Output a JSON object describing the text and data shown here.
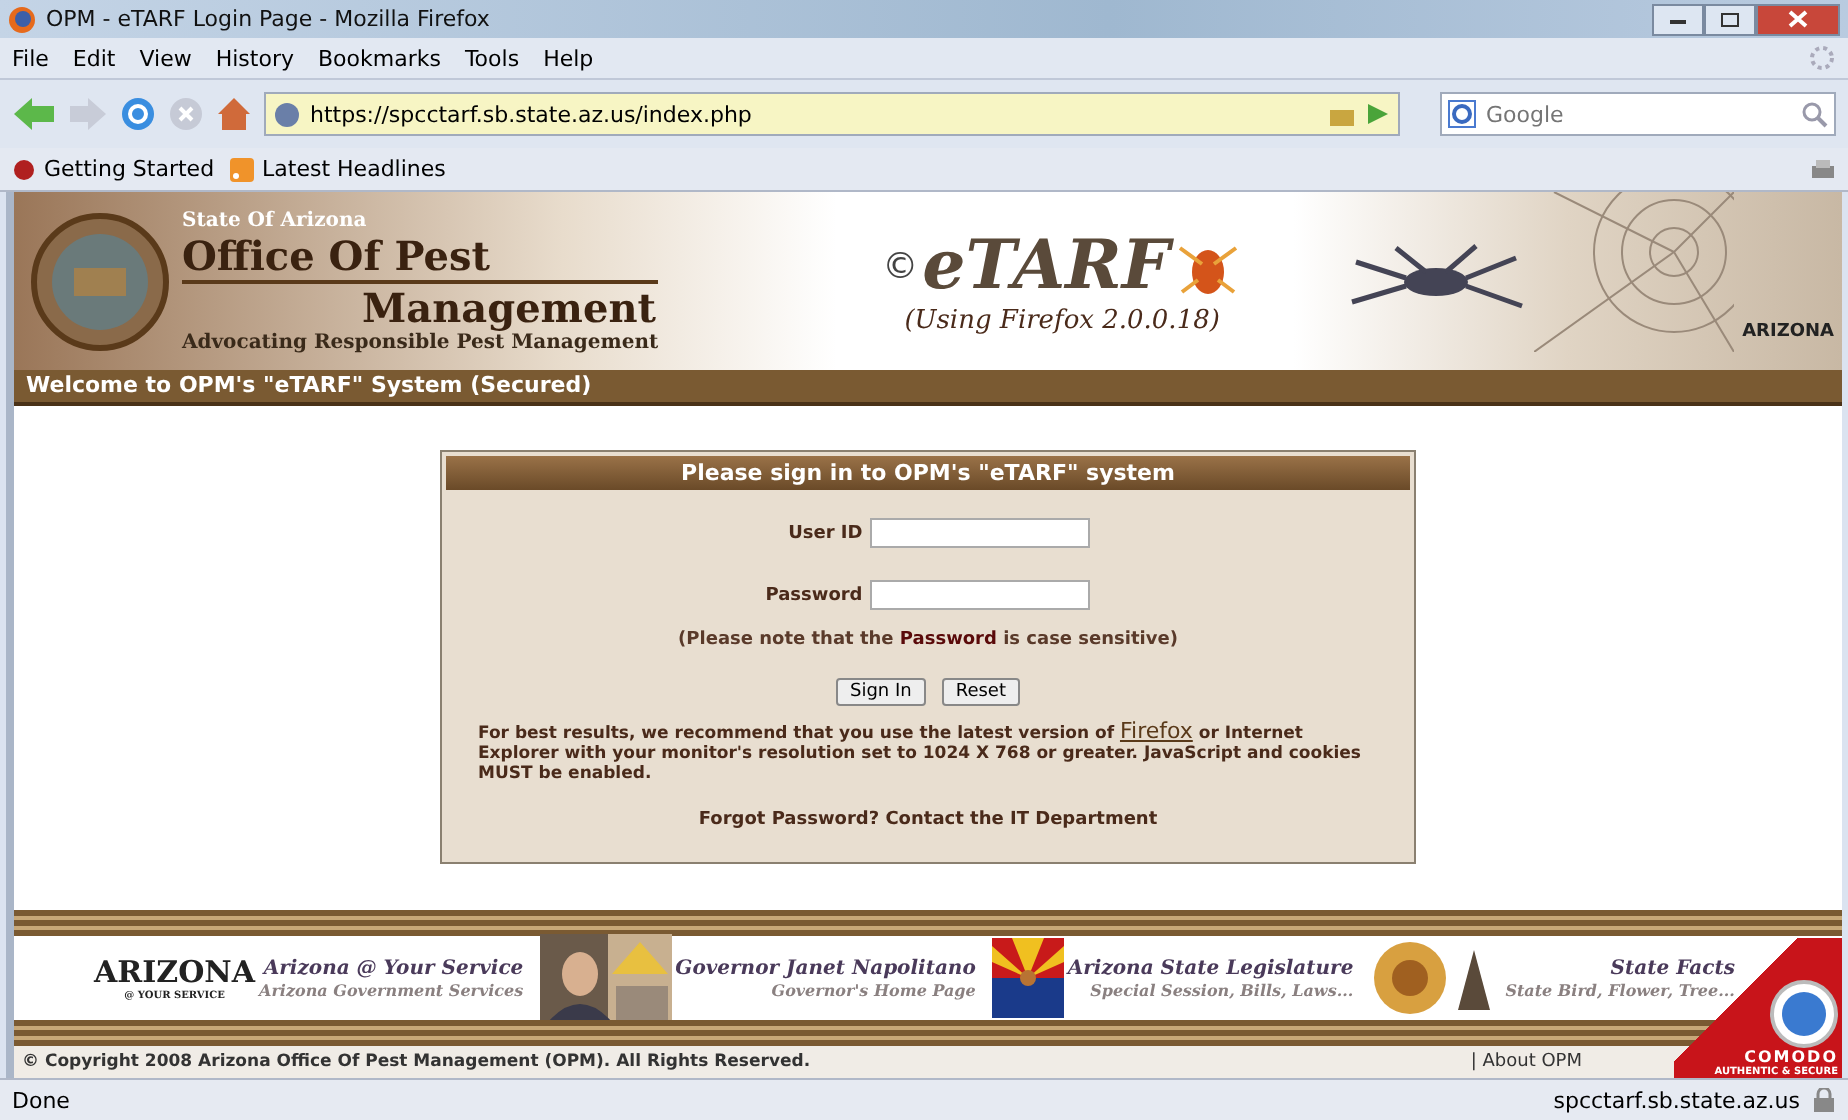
{
  "window": {
    "title": "OPM - eTARF Login Page - Mozilla Firefox"
  },
  "menu": [
    "File",
    "Edit",
    "View",
    "History",
    "Bookmarks",
    "Tools",
    "Help"
  ],
  "address": {
    "value": "https://spcctarf.sb.state.az.us/index.php"
  },
  "search": {
    "placeholder": "Google"
  },
  "bookmarks": [
    {
      "label": "Getting Started",
      "kind": "start"
    },
    {
      "label": "Latest Headlines",
      "kind": "feed"
    }
  ],
  "banner": {
    "state": "State Of Arizona",
    "office_line1": "Office Of Pest",
    "office_line2": "Management",
    "motto": "Advocating Responsible Pest Management",
    "logo_mark": "©",
    "logo_text": "eTARF",
    "version_note": "(Using Firefox 2.0.0.18)",
    "corner_logo": "ARIZONA"
  },
  "welcome": "Welcome to OPM's \"eTARF\" System (Secured)",
  "login": {
    "heading": "Please sign in to OPM's \"eTARF\" system",
    "fields": [
      {
        "label": "User ID"
      },
      {
        "label": "Password"
      }
    ],
    "note": "(Please note that the **Password** is case sensitive)",
    "buttons": [
      "Sign In",
      "Reset"
    ],
    "advice_before": "For best results, we recommend that you use the latest version of",
    "advice_link": "Firefox",
    "advice_after": "or Internet Explorer with your monitor's resolution set to 1024 X 768 or greater. JavaScript and cookies MUST be enabled.",
    "forgot": "Forgot Password? Contact the IT Department"
  },
  "footer_links": [
    {
      "kind": "arizona",
      "logo": "ARIZONA",
      "logo_sub": "@ YOUR SERVICE",
      "title": "Arizona @ Your Service",
      "subtitle": "Arizona Government Services"
    },
    {
      "kind": "governor",
      "title": "Governor Janet Napolitano",
      "subtitle": "Governor's Home Page"
    },
    {
      "kind": "legislature",
      "title": "Arizona State Legislature",
      "subtitle": "Special Session, Bills, Laws..."
    },
    {
      "kind": "facts",
      "title": "State Facts",
      "subtitle": "State Bird, Flower, Tree..."
    }
  ],
  "copyright": "© Copyright 2008 Arizona Office Of Pest Management (OPM). All Rights Reserved.",
  "about": "| About OPM",
  "seal": {
    "brand": "COMODO",
    "tagline": "AUTHENTIC & SECURE"
  },
  "status_bar": {
    "text": "Done",
    "host": "spcctarf.sb.state.az.us"
  }
}
